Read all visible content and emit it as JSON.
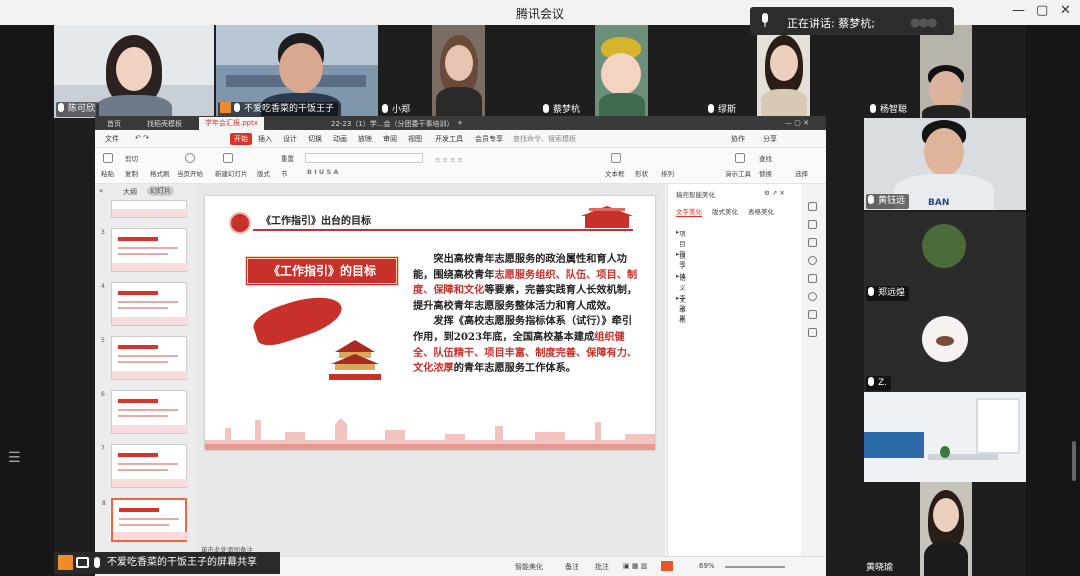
{
  "window": {
    "title": "腾讯会议",
    "speaking_label": "正在讲话: 蔡梦杭;"
  },
  "participants": [
    {
      "name": "陈可欣"
    },
    {
      "name": "不爱吃香菜的干饭王子"
    },
    {
      "name": "小郑"
    },
    {
      "name": "蔡梦杭"
    },
    {
      "name": "缪斯"
    },
    {
      "name": "杨智聪"
    },
    {
      "name": "黄钰远"
    },
    {
      "name": "郑远煌"
    },
    {
      "name": "Z."
    },
    {
      "name": "黄晓瑜"
    }
  ],
  "share_banner": "不爱吃香菜的干饭王子的屏幕共享",
  "wps": {
    "tabs": [
      "首页",
      "找稻壳模板",
      "学年会汇报.pptx",
      "22-23（1）学...会（分团委干事培训）"
    ],
    "menu": [
      "文件",
      "开始",
      "插入",
      "设计",
      "切换",
      "动画",
      "放映",
      "审阅",
      "视图",
      "开发工具",
      "会员专享",
      "查找命令、搜索模板"
    ],
    "menu_right": [
      "协作",
      "分享"
    ],
    "toolbar": [
      "粘贴",
      "剪切",
      "复制",
      "格式刷",
      "当页开始",
      "新建幻灯片",
      "版式",
      "节",
      "重置",
      "文本框",
      "形状",
      "排列",
      "演示工具",
      "查找",
      "替换",
      "选择"
    ],
    "thumbs_header": [
      "大纲",
      "幻灯片"
    ],
    "thumb_numbers": [
      "3",
      "4",
      "5",
      "6",
      "7",
      "8"
    ],
    "notes": "单击此处添加备注",
    "pane_title": "稿壳智能美化",
    "pane_tabs": [
      "文字美化",
      "版式美化",
      "表格美化"
    ],
    "pane_items": [
      "项目符号",
      "换字体",
      "语义字效果",
      "文本框"
    ],
    "status_items": [
      "智能美化",
      "备注",
      "批注",
      "69%"
    ]
  },
  "slide": {
    "heading": "《工作指引》出台的目标",
    "box_label": "《工作指引》的目标",
    "p1_a": "突出高校青年志愿服务的政治属性和育人功能，围绕高校青年",
    "p1_red": "志愿服务组织、队伍、项目、制度、保障和文化",
    "p1_b": "等要素，完善实践育人长效机制，提升高校青年志愿服务整体活力和育人成效。",
    "p2_a": "发挥《高校志愿服务指标体系（试行）》牵引作用，到2023年底，全国高校基本建成",
    "p2_red": "组织健全、队伍精干、项目丰富、制度完善、保障有力、文化浓厚",
    "p2_b": "的青年志愿服务工作体系。"
  }
}
